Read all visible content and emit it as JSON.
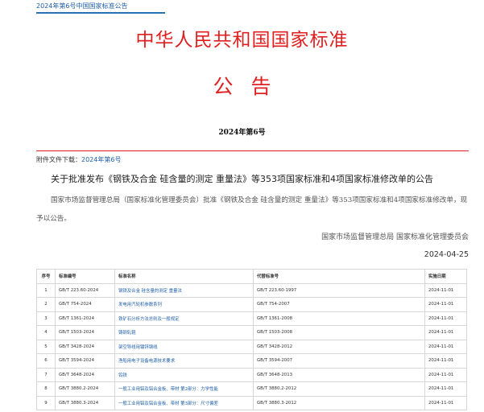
{
  "breadcrumb": "2024年第6号中国国家标准公告",
  "title": "中华人民共和国国家标准",
  "subtitle": "公告",
  "issue": "2024年第6号",
  "attachment": {
    "label": "附件文件下载：",
    "link": "2024年第6号"
  },
  "notice_title": "关于批准发布《钢铁及合金 硅含量的测定 重量法》等353项国家标准和4项国家标准修改单的公告",
  "body": "国家市场监督管理总局（国家标准化管理委员会）批准《钢铁及合金 硅含量的测定 重量法》等353项国家标准和4项国家标准修改单，现予以公告。",
  "signatory": "国家市场监督管理总局 国家标准化管理委员会",
  "date": "2024-04-25",
  "table": {
    "headers": [
      "序号",
      "标准编号",
      "标准名称",
      "代替标准号",
      "实施日期"
    ],
    "rows": [
      [
        "1",
        "GB/T 223.60-2024",
        "钢铁及合金 硅含量的测定 重量法",
        "GB/T 223.60-1997",
        "2024-11-01"
      ],
      [
        "2",
        "GB/T 754-2024",
        "发电用汽轮机参数系列",
        "GB/T 754-2007",
        "2024-11-01"
      ],
      [
        "3",
        "GB/T 1361-2024",
        "铁矿石分析方法总则及一般规定",
        "GB/T 1361-2008",
        "2024-11-01"
      ],
      [
        "4",
        "GB/T 1503-2024",
        "铸钢轧辊",
        "GB/T 1503-2008",
        "2024-11-01"
      ],
      [
        "5",
        "GB/T 3428-2024",
        "架空导线用镀锌钢线",
        "GB/T 3428-2012",
        "2024-11-01"
      ],
      [
        "6",
        "GB/T 3594-2024",
        "渔船用电子设备电源技术要求",
        "GB/T 3594-2007",
        "2024-11-01"
      ],
      [
        "7",
        "GB/T 3648-2024",
        "钨铁",
        "GB/T 3648-2013",
        "2024-11-01"
      ],
      [
        "8",
        "GB/T 3880.2-2024",
        "一般工业用铝及铝合金板、带材 第2部分：力学性能",
        "GB/T 3880.2-2012",
        "2024-11-01"
      ],
      [
        "9",
        "GB/T 3880.3-2024",
        "一般工业用铝及铝合金板、带材 第3部分：尺寸偏差",
        "GB/T 3880.3-2012",
        "2024-11-01"
      ]
    ]
  }
}
